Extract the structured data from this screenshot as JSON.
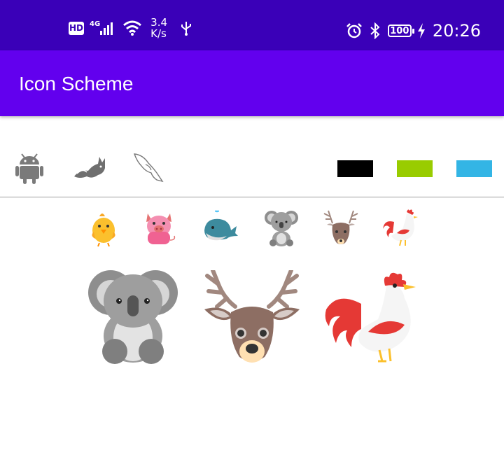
{
  "status_bar": {
    "hd": "HD",
    "network": "4G",
    "speed_value": "3.4",
    "speed_unit": "K/s",
    "battery": "100",
    "time": "20:26",
    "icons": [
      "signal-icon",
      "wifi-icon",
      "usb-icon",
      "alarm-icon",
      "bluetooth-icon",
      "battery-icon",
      "charging-icon"
    ]
  },
  "app_bar": {
    "title": "Icon Scheme",
    "color": "#6200ee",
    "status_color": "#3a00b8"
  },
  "toolbar_icons": [
    "android-icon",
    "tomcat-icon",
    "mysql-dolphin-icon"
  ],
  "color_swatches": [
    "#000000",
    "#99cc00",
    "#33b5e5"
  ],
  "small_animals": [
    "chick-icon",
    "pig-icon",
    "whale-icon",
    "koala-icon",
    "deer-icon",
    "rooster-icon"
  ],
  "large_animals": [
    "koala-icon",
    "deer-icon",
    "rooster-icon"
  ]
}
